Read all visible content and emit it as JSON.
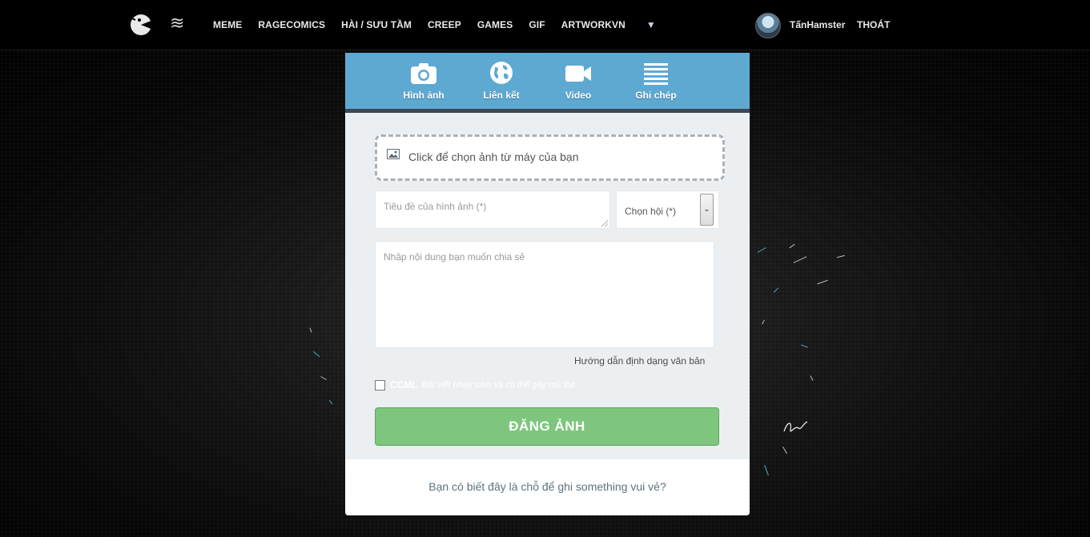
{
  "nav": {
    "items": [
      "MEME",
      "RAGECOMICS",
      "HÀI / SƯU TẦM",
      "CREEP",
      "GAMES",
      "GIF",
      "ARTWORKVN"
    ],
    "more": "▼",
    "username": "TấnHamster",
    "logout": "THOÁT"
  },
  "tabs": [
    {
      "label": "Hình ảnh",
      "icon": "camera-icon"
    },
    {
      "label": "Liên kết",
      "icon": "globe-icon"
    },
    {
      "label": "Video",
      "icon": "video-camera-icon"
    },
    {
      "label": "Ghi chép",
      "icon": "lines-icon"
    }
  ],
  "form": {
    "upload_text": "Click để chọn ảnh từ máy của bạn",
    "title_placeholder": "Tiêu đề của hình ảnh (*)",
    "group_select": "Chọn hội (*)",
    "content_placeholder": "Nhập nội dung bạn muốn chia sẻ",
    "guide_link": "Hướng dẫn định dạng văn bản",
    "nsfw_label": "CCML",
    "nsfw_desc": "Bài viết nhạy cảm và có thể gây mù lòa",
    "submit": "ĐĂNG ẢNH"
  },
  "footer_text": "Bạn có biết đây là chỗ để ghi something vui vẻ?",
  "colors": {
    "tab_bar": "#5ea9d2",
    "submit_bg": "#7ec67d",
    "panel_bg": "#eceff2"
  }
}
